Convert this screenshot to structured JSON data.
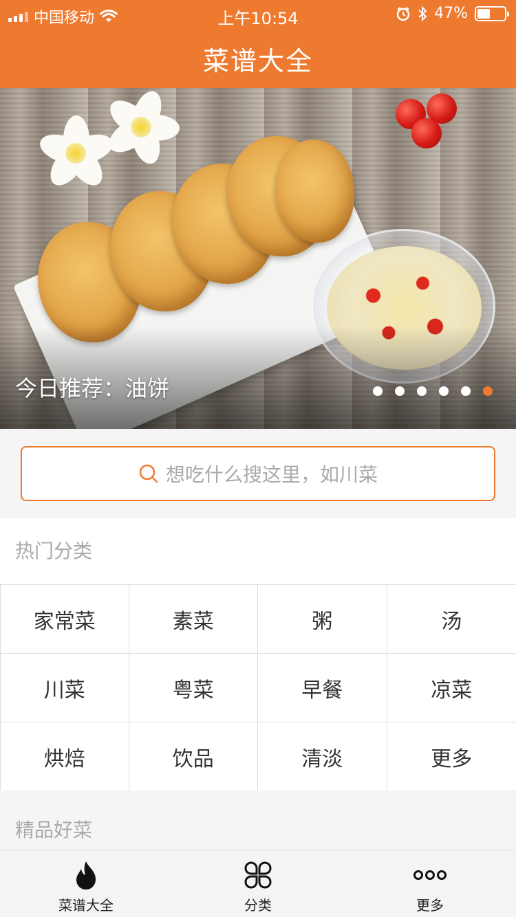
{
  "status_bar": {
    "carrier": "中国移动",
    "time": "上午10:54",
    "battery": "47%"
  },
  "header": {
    "title": "菜谱大全"
  },
  "banner": {
    "caption": "今日推荐：油饼",
    "dots_total": 6,
    "active_dot": 6
  },
  "search": {
    "placeholder": "想吃什么搜这里，如川菜"
  },
  "hot_categories": {
    "title": "热门分类",
    "items": [
      "家常菜",
      "素菜",
      "粥",
      "汤",
      "川菜",
      "粤菜",
      "早餐",
      "凉菜",
      "烘焙",
      "饮品",
      "清淡",
      "更多"
    ]
  },
  "featured": {
    "title": "精品好菜"
  },
  "tabbar": {
    "tabs": [
      {
        "label": "菜谱大全",
        "icon": "flame-icon"
      },
      {
        "label": "分类",
        "icon": "grid-clover-icon"
      },
      {
        "label": "更多",
        "icon": "more-dots-icon"
      }
    ]
  },
  "colors": {
    "accent": "#ee7a30"
  }
}
